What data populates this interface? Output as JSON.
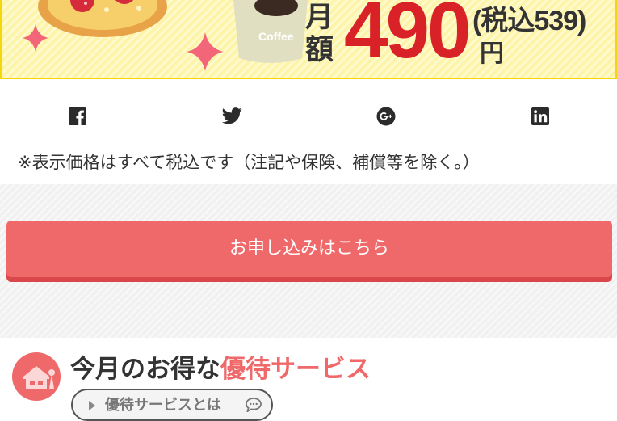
{
  "banner": {
    "coffee_label": "Coffee",
    "price_label_month": "月",
    "price_label_amount": "額",
    "price_value": "490",
    "price_tax": "(税込539)",
    "price_unit": "円"
  },
  "share": {
    "icons": [
      "facebook-icon",
      "twitter-icon",
      "google-plus-icon",
      "linkedin-icon"
    ]
  },
  "note": "※表示価格はすべて税込です（注記や保険、補償等を除く。）",
  "cta": {
    "label": "お申し込みはこちら"
  },
  "section": {
    "title_prefix": "今月のお得な",
    "title_highlight": "優待サービス",
    "pill_label": "優待サービスとは",
    "icon": "house-icon"
  },
  "colors": {
    "banner_bg": "#fdf4a8",
    "banner_border": "#f5d60a",
    "price_red": "#d92128",
    "accent": "#f0696a",
    "accent_shadow": "#d9474a"
  }
}
